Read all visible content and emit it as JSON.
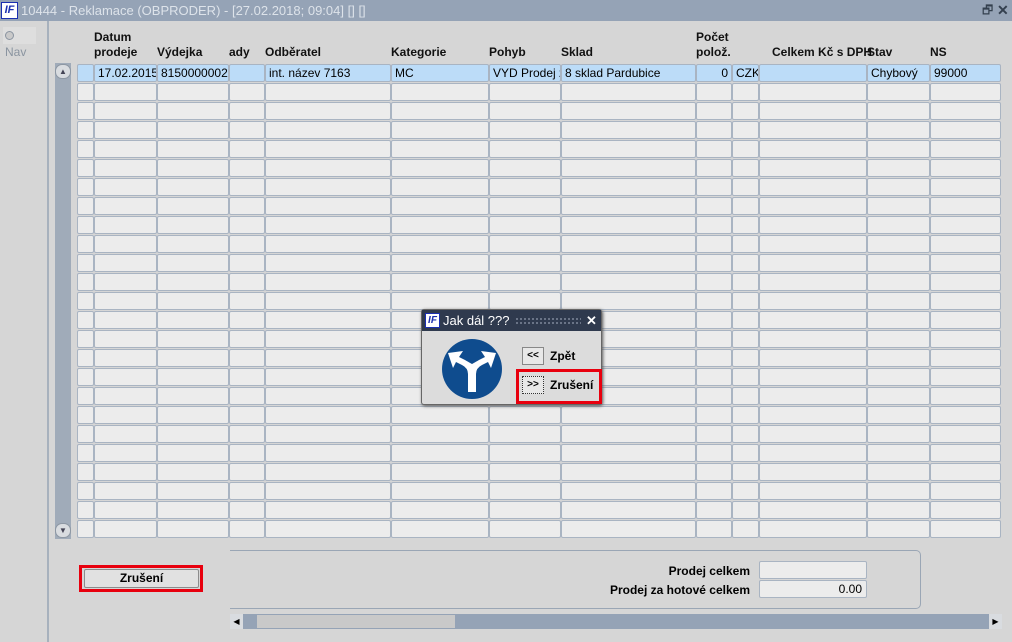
{
  "window": {
    "logo": "IF",
    "title": "10444 - Reklamace (OBPRODER) - [27.02.2018; 09:04]  []  []",
    "restore_icon": "restore-icon",
    "close_icon": "close-icon"
  },
  "nav": {
    "label": "Nav"
  },
  "table": {
    "headers": [
      {
        "line1": "Datum",
        "line2": "prodeje"
      },
      {
        "line1": "",
        "line2": "Výdejka"
      },
      {
        "line1": "",
        "line2": "ady"
      },
      {
        "line1": "",
        "line2": "Odběratel"
      },
      {
        "line1": "",
        "line2": "Kategorie"
      },
      {
        "line1": "",
        "line2": "Pohyb"
      },
      {
        "line1": "",
        "line2": "Sklad"
      },
      {
        "line1": "Počet",
        "line2": "polož."
      },
      {
        "line1": "",
        "line2": ""
      },
      {
        "line1": "",
        "line2": "Celkem Kč s DPH"
      },
      {
        "line1": "",
        "line2": "Stav"
      },
      {
        "line1": "",
        "line2": "NS"
      }
    ],
    "rows": [
      [
        "17.02.2015",
        "8150000002",
        "",
        "int. název 7163",
        "MC",
        "VYD Prodej zl",
        "8  sklad Pardubice",
        "0",
        "CZK",
        "",
        "Chybový",
        "99000"
      ]
    ],
    "empty_rows": 24
  },
  "dialog": {
    "logo": "IF",
    "title": "Jak dál ???",
    "icon": "fork-arrow-icon",
    "back_button": "<<",
    "back_label": "Zpět",
    "cancel_button": ">>",
    "cancel_label": "Zrušení"
  },
  "footer": {
    "cancel_button": "Zrušení",
    "prodej_celkem_label": "Prodej celkem",
    "prodej_celkem_value": "",
    "prodej_hotove_label": "Prodej za hotové celkem",
    "prodej_hotove_value": "0.00"
  },
  "colors": {
    "titlebar": "#95a3b6",
    "selected_row": "#bcdcf8",
    "highlight": "#e8000e",
    "dialog_title": "#2f3a4e"
  }
}
